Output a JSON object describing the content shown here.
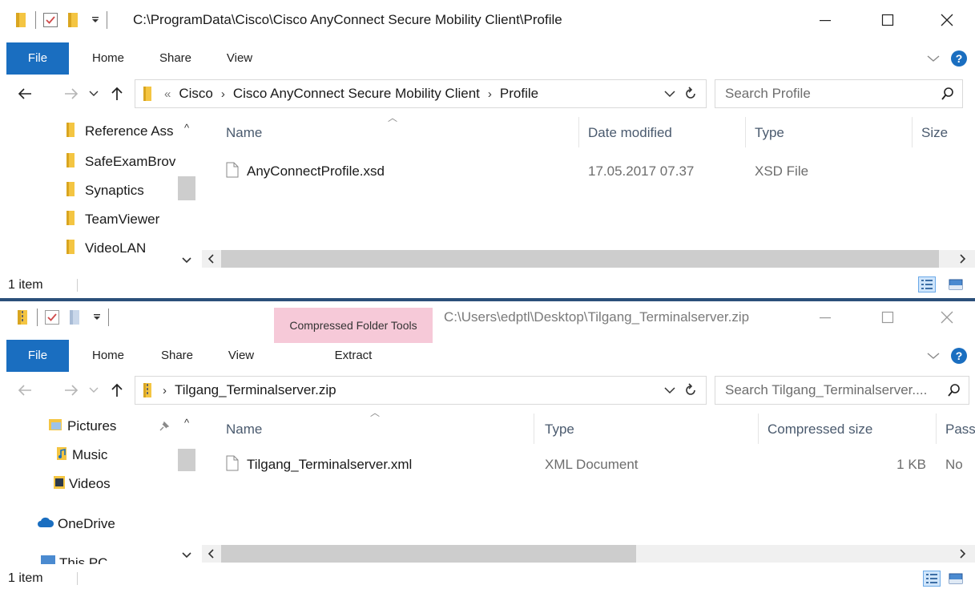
{
  "window1": {
    "title": "C:\\ProgramData\\Cisco\\Cisco AnyConnect Secure Mobility Client\\Profile",
    "tabs": [
      "File",
      "Home",
      "Share",
      "View"
    ],
    "breadcrumb": {
      "overflow": "«",
      "items": [
        "Cisco",
        "Cisco AnyConnect Secure Mobility Client",
        "Profile"
      ]
    },
    "search_placeholder": "Search Profile",
    "nav_items": [
      "Reference Ass",
      "SafeExamBrov",
      "Synaptics",
      "TeamViewer",
      "VideoLAN"
    ],
    "columns": [
      "Name",
      "Date modified",
      "Type",
      "Size"
    ],
    "files": [
      {
        "name": "AnyConnectProfile.xsd",
        "date_modified": "17.05.2017 07.37",
        "type": "XSD File"
      }
    ],
    "status_text": "1 item"
  },
  "window2": {
    "context_tool": "Compressed Folder Tools",
    "context_tab": "Extract",
    "title": "C:\\Users\\edptl\\Desktop\\Tilgang_Terminalserver.zip",
    "tabs": [
      "File",
      "Home",
      "Share",
      "View"
    ],
    "breadcrumb": {
      "items": [
        "Tilgang_Terminalserver.zip"
      ]
    },
    "search_placeholder": "Search Tilgang_Terminalserver....",
    "nav_items": [
      "Pictures",
      "Music",
      "Videos",
      "OneDrive",
      "This PC"
    ],
    "columns": [
      "Name",
      "Type",
      "Compressed size",
      "Passw"
    ],
    "files": [
      {
        "name": "Tilgang_Terminalserver.xml",
        "type": "XML Document",
        "compressed_size": "1 KB",
        "password_protected": "No"
      }
    ],
    "status_text": "1 item"
  },
  "icons": {
    "folder": "folder-icon",
    "file": "file-icon",
    "zip": "zip-folder-icon",
    "search": "search-icon",
    "refresh": "refresh-icon",
    "help": "help-icon",
    "pin": "pin-icon",
    "onedrive": "onedrive-icon"
  },
  "colors": {
    "file_tab": "#1a6ec0",
    "context_tool": "#f6c9d8",
    "folder_yellow": "#f4c542",
    "help_blue": "#1a6ec0",
    "column_header_text": "#4a5a6e"
  }
}
